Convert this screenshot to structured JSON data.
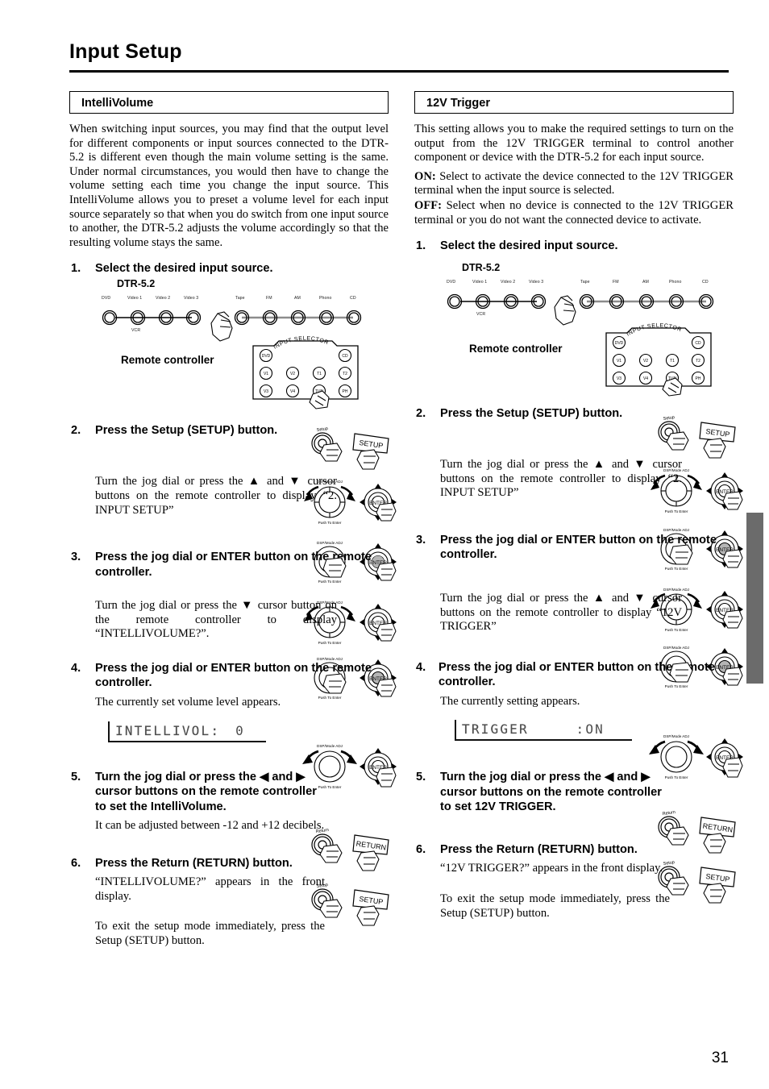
{
  "page": {
    "title": "Input Setup",
    "number": "31"
  },
  "left": {
    "section_title": "IntelliVolume",
    "intro": "When switching input sources, you may find that the output level for different components or input sources connected to the DTR-5.2 is different even though the main volume setting is the same. Under normal circumstances, you would then have to change the volume setting each time you change the input source. This IntelliVolume allows you to preset a volume level for each input source separately so that when you do switch from one input source to another, the DTR-5.2 adjusts the volume accordingly so that the resulting volume stays the same.",
    "steps": [
      {
        "num": "1.",
        "text": "Select the desired input source."
      },
      {
        "num": "2.",
        "text": "Press the Setup (SETUP) button."
      },
      {
        "num": "3.",
        "text": "Press the jog dial or ENTER button on the remote controller."
      },
      {
        "num": "4.",
        "text": "Press the jog dial or ENTER button on the remote controller."
      },
      {
        "num": "5.",
        "text": "Turn the jog dial or press the ◀ and ▶ cursor buttons on the remote controller to set the IntelliVolume."
      },
      {
        "num": "6.",
        "text": "Press the Return (RETURN) button."
      }
    ],
    "sub_step2": "Turn the jog dial or press the ▲ and ▼ cursor buttons on the remote controller to display “2. INPUT SETUP”",
    "sub_step3": "Turn the jog dial or press the ▼ cursor button on the remote controller to display “INTELLIVOLUME?”.",
    "sub_step4": "The currently set volume level appears.",
    "sub_step5": "It can be adjusted between -12 and +12 decibels.",
    "sub_step6a": "“INTELLIVOLUME?” appears in the front display.",
    "sub_step6b": "To exit the setup mode immediately, press the Setup (SETUP) button.",
    "lcd": {
      "label": "INTELLIVOL:",
      "value": "0"
    }
  },
  "right": {
    "section_title": "12V Trigger",
    "intro": "This setting allows you to make the required settings to turn on the output from the 12V TRIGGER terminal to control another component or device with the DTR-5.2 for each input source.",
    "on_label": "ON:",
    "on_text": " Select to activate the device connected to the 12V TRIGGER terminal when the input source is selected.",
    "off_label": "OFF:",
    "off_text": " Select when no device is connected to the 12V TRIGGER terminal or you do not want the connected device to activate.",
    "steps": [
      {
        "num": "1.",
        "text": "Select the desired input source."
      },
      {
        "num": "2.",
        "text": "Press the Setup (SETUP) button."
      },
      {
        "num": "3.",
        "text": "Press the jog dial or ENTER button on the remote controller."
      },
      {
        "num": "4.",
        "text": "Press the jog dial or ENTER button on the remote controller."
      },
      {
        "num": "5.",
        "text": "Turn the jog dial or press the ◀ and ▶ cursor buttons on the remote controller to set 12V TRIGGER."
      },
      {
        "num": "6.",
        "text": "Press the Return (RETURN) button."
      }
    ],
    "sub_step2": "Turn the jog dial or press the ▲ and ▼ cursor buttons on the remote controller to display “2. INPUT SETUP”",
    "sub_step3": "Turn the jog dial or press the ▲ and ▼ cursor buttons on the remote controller to display “12V TRIGGER”",
    "sub_step4": "The currently setting appears.",
    "sub_step6a": "“12V TRIGGER?” appears in the front display.",
    "sub_step6b": "To exit the setup mode immediately, press the Setup (SETUP) button.",
    "lcd": {
      "label": "TRIGGER",
      "value": ":ON"
    }
  },
  "diagram": {
    "device_label": "DTR-5.2",
    "remote_label": "Remote controller",
    "panel_buttons_left": [
      "DVD",
      "Video 1",
      "Video 2",
      "Video 3"
    ],
    "panel_sub_label": "VCR",
    "panel_buttons_right": [
      "Tape",
      "FM",
      "AM",
      "Phono",
      "CD"
    ],
    "remote_header": "INPUT SELECTOR",
    "remote_keys_row1": [
      "DVD",
      "CD"
    ],
    "remote_keys_row2": [
      "V1",
      "V2",
      "T1",
      "T2"
    ],
    "remote_keys_row3": [
      "V3",
      "V4",
      "TUN",
      "PH"
    ],
    "jog_top_label": "DSP/Mode ADJ",
    "jog_bottom_label": "Push To Enter",
    "enter_label": "ENTER",
    "setup_small_label": "Setup",
    "setup_key_label": "SETUP",
    "return_small_label": "Return",
    "return_key_label": "RETURN"
  }
}
